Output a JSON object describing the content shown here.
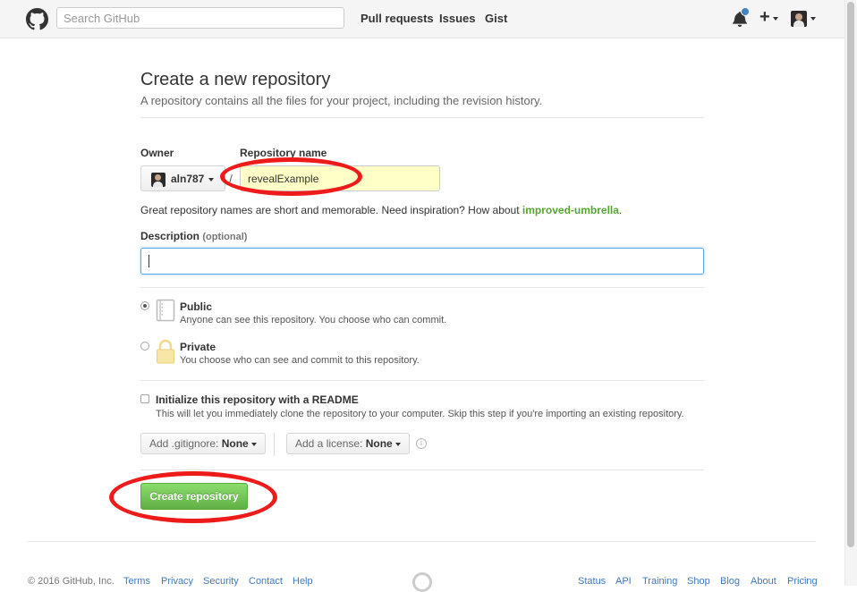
{
  "header": {
    "search_placeholder": "Search GitHub",
    "nav": [
      "Pull requests",
      "Issues",
      "Gist"
    ]
  },
  "page": {
    "title": "Create a new repository",
    "subtitle": "A repository contains all the files for your project, including the revision history."
  },
  "form": {
    "owner_label": "Owner",
    "owner_value": "aln787",
    "repo_label": "Repository name",
    "repo_value": "revealExample",
    "hint_prefix": "Great repository names are short and memorable. Need inspiration? How about ",
    "hint_suggestion": "improved-umbrella",
    "hint_suffix": ".",
    "description_label": "Description",
    "description_optional": "(optional)",
    "description_value": "",
    "visibility": {
      "selected": "Public",
      "public_title": "Public",
      "public_desc": "Anyone can see this repository. You choose who can commit.",
      "private_title": "Private",
      "private_desc": "You choose who can see and commit to this repository."
    },
    "init_readme": {
      "checked": false,
      "title": "Initialize this repository with a README",
      "desc": "This will let you immediately clone the repository to your computer. Skip this step if you're importing an existing repository."
    },
    "gitignore_label": "Add .gitignore:",
    "gitignore_value": "None",
    "license_label": "Add a license:",
    "license_value": "None",
    "create_button": "Create repository"
  },
  "annotation_color": "#ee1b1b",
  "accent_colors": {
    "green_button": "#60b044",
    "suggestion": "#55a532",
    "link": "#4078c0",
    "repo_input_bg": "#ffffc8"
  },
  "footer": {
    "copyright": "© 2016 GitHub, Inc.",
    "left_links": [
      "Terms",
      "Privacy",
      "Security",
      "Contact",
      "Help"
    ],
    "right_links": [
      "Status",
      "API",
      "Training",
      "Shop",
      "Blog",
      "About",
      "Pricing"
    ]
  }
}
